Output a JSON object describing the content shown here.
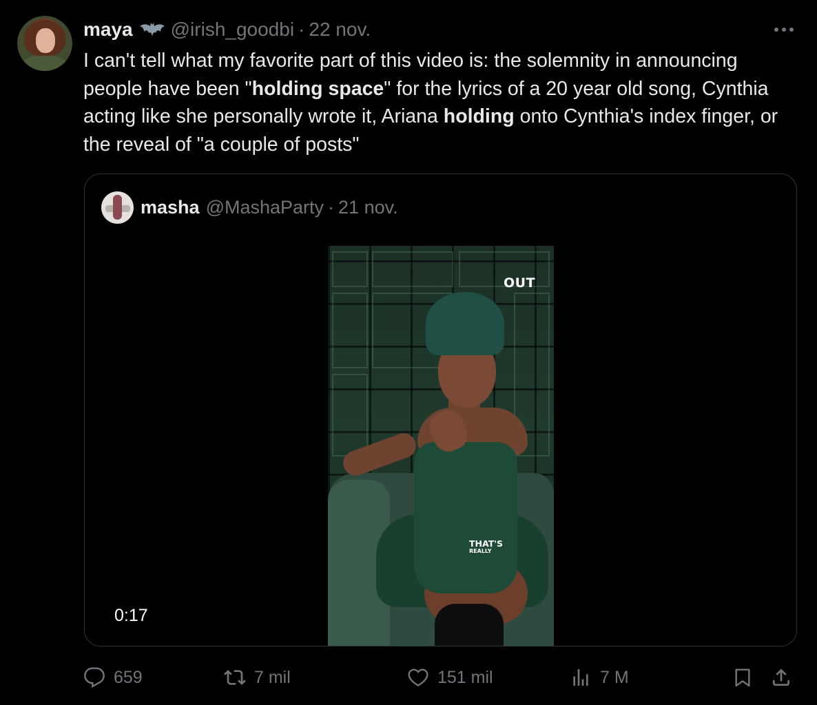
{
  "tweet": {
    "author": {
      "name": "maya",
      "handle": "@irish_goodbi",
      "separator": "·",
      "date": "22 nov."
    },
    "text_parts": {
      "p1": "I can't tell what my favorite part of this video is: the solemnity in announcing people have been \"",
      "b1": "holding space",
      "p2": "\" for the lyrics of a 20 year old song, Cynthia acting like she personally wrote it, Ariana ",
      "b2": "holding",
      "p3": " onto Cynthia's index finger, or the reveal of \"a couple of posts\""
    },
    "more_icon": "more-horizontal-icon"
  },
  "quote": {
    "author": {
      "name": "masha",
      "handle": "@MashaParty",
      "separator": "·",
      "date": "21 nov."
    },
    "video": {
      "logo": "OUT",
      "caption_line1": "THAT'S",
      "caption_line2": "REALLY",
      "timestamp": "0:17"
    }
  },
  "actions": {
    "reply": {
      "icon": "reply-icon",
      "count": "659"
    },
    "retweet": {
      "icon": "retweet-icon",
      "count": "7 mil"
    },
    "like": {
      "icon": "heart-icon",
      "count": "151 mil"
    },
    "views": {
      "icon": "views-icon",
      "count": "7 M"
    },
    "bookmark": {
      "icon": "bookmark-icon"
    },
    "share": {
      "icon": "share-icon"
    }
  },
  "colors": {
    "background": "#000000",
    "text": "#e7e9ea",
    "secondary": "#71767b",
    "border": "#2f3336"
  }
}
